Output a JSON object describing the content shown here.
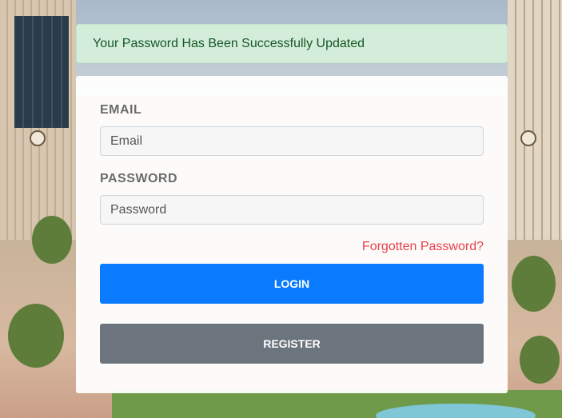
{
  "alert": {
    "message": "Your Password Has Been Successfully Updated"
  },
  "form": {
    "email_label": "EMAIL",
    "email_placeholder": "Email",
    "email_value": "",
    "password_label": "PASSWORD",
    "password_placeholder": "Password",
    "password_value": "",
    "forgot_link": "Forgotten Password?",
    "login_button": "LOGIN",
    "register_button": "REGISTER"
  },
  "colors": {
    "alert_bg": "#d4edda",
    "alert_text": "#155724",
    "link": "#e8414b",
    "login": "#0a7bff",
    "register": "#6c757d"
  }
}
